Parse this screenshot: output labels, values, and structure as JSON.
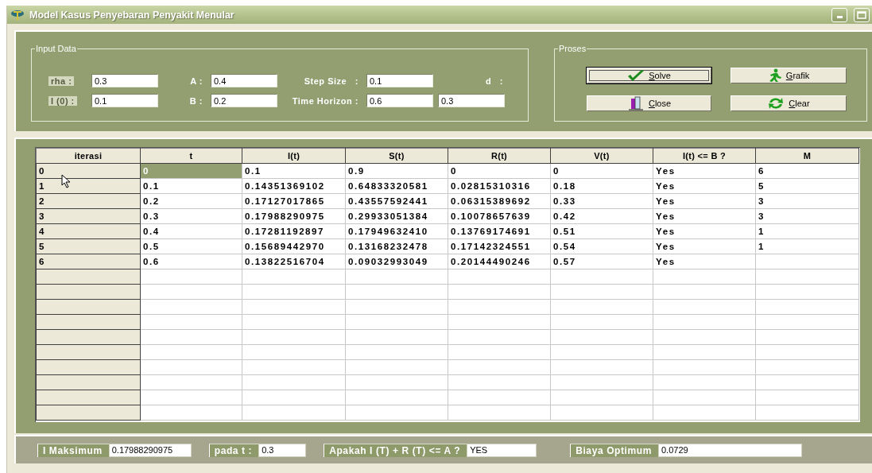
{
  "window": {
    "title": "Model Kasus Penyebaran Penyakit Menular"
  },
  "input_data": {
    "title": "Input Data",
    "rows": [
      [
        {
          "kind": "label",
          "text": "rha :",
          "highlighted": true
        },
        {
          "kind": "field",
          "value": "0.3"
        },
        {
          "kind": "label",
          "text": "A :",
          "highlighted": false
        },
        {
          "kind": "field",
          "value": "0.4"
        },
        {
          "kind": "label",
          "text": "Step Size   :",
          "highlighted": false
        },
        {
          "kind": "field",
          "value": "0.1"
        },
        {
          "kind": "label",
          "text": "d   :",
          "highlighted": false
        }
      ],
      [
        {
          "kind": "label",
          "text": "I (0) :",
          "highlighted": true
        },
        {
          "kind": "field",
          "value": "0.1"
        },
        {
          "kind": "label",
          "text": "B :",
          "highlighted": false
        },
        {
          "kind": "field",
          "value": "0.2"
        },
        {
          "kind": "label",
          "text": "Time Horizon :",
          "highlighted": false
        },
        {
          "kind": "field",
          "value": "0.6"
        },
        {
          "kind": "field",
          "value": "0.3"
        }
      ]
    ]
  },
  "proses": {
    "title": "Proses",
    "buttons": [
      {
        "label": "Solve",
        "kind": "check",
        "focused": true
      },
      {
        "label": "Grafik",
        "kind": "runner",
        "focused": false
      },
      {
        "label": "Close",
        "kind": "door",
        "focused": false
      },
      {
        "label": "Clear",
        "kind": "refresh",
        "focused": false
      }
    ]
  },
  "table": {
    "columns": [
      "iterasi",
      "t",
      "I(t)",
      "S(t)",
      "R(t)",
      "V(t)",
      "I(t) <= B ?",
      "M"
    ],
    "rows": [
      {
        "cells": [
          {
            "text": "0",
            "selected": false
          },
          {
            "text": "0",
            "selected": true
          },
          {
            "text": "0.1",
            "selected": false
          },
          {
            "text": "0.9",
            "selected": false
          },
          {
            "text": "0",
            "selected": false
          },
          {
            "text": "0",
            "selected": false
          },
          {
            "text": "Yes",
            "selected": false
          },
          {
            "text": "6",
            "selected": false
          }
        ]
      },
      {
        "cells": [
          {
            "text": "1",
            "selected": false
          },
          {
            "text": "0.1",
            "selected": false
          },
          {
            "text": "0.14351369102",
            "selected": false
          },
          {
            "text": "0.64833320581",
            "selected": false
          },
          {
            "text": "0.02815310316",
            "selected": false
          },
          {
            "text": "0.18",
            "selected": false
          },
          {
            "text": "Yes",
            "selected": false
          },
          {
            "text": "5",
            "selected": false
          }
        ]
      },
      {
        "cells": [
          {
            "text": "2",
            "selected": false
          },
          {
            "text": "0.2",
            "selected": false
          },
          {
            "text": "0.17127017865",
            "selected": false
          },
          {
            "text": "0.43557592441",
            "selected": false
          },
          {
            "text": "0.06315389692",
            "selected": false
          },
          {
            "text": "0.33",
            "selected": false
          },
          {
            "text": "Yes",
            "selected": false
          },
          {
            "text": "3",
            "selected": false
          }
        ]
      },
      {
        "cells": [
          {
            "text": "3",
            "selected": false
          },
          {
            "text": "0.3",
            "selected": false
          },
          {
            "text": "0.17988290975",
            "selected": false
          },
          {
            "text": "0.29933051384",
            "selected": false
          },
          {
            "text": "0.10078657639",
            "selected": false
          },
          {
            "text": "0.42",
            "selected": false
          },
          {
            "text": "Yes",
            "selected": false
          },
          {
            "text": "3",
            "selected": false
          }
        ]
      },
      {
        "cells": [
          {
            "text": "4",
            "selected": false
          },
          {
            "text": "0.4",
            "selected": false
          },
          {
            "text": "0.17281192897",
            "selected": false
          },
          {
            "text": "0.17949632410",
            "selected": false
          },
          {
            "text": "0.13769174691",
            "selected": false
          },
          {
            "text": "0.51",
            "selected": false
          },
          {
            "text": "Yes",
            "selected": false
          },
          {
            "text": "1",
            "selected": false
          }
        ]
      },
      {
        "cells": [
          {
            "text": "5",
            "selected": false
          },
          {
            "text": "0.5",
            "selected": false
          },
          {
            "text": "0.15689442970",
            "selected": false
          },
          {
            "text": "0.13168232478",
            "selected": false
          },
          {
            "text": "0.17142324551",
            "selected": false
          },
          {
            "text": "0.54",
            "selected": false
          },
          {
            "text": "Yes",
            "selected": false
          },
          {
            "text": "1",
            "selected": false
          }
        ]
      },
      {
        "cells": [
          {
            "text": "6",
            "selected": false
          },
          {
            "text": "0.6",
            "selected": false
          },
          {
            "text": "0.13822516704",
            "selected": false
          },
          {
            "text": "0.09032993049",
            "selected": false
          },
          {
            "text": "0.20144490246",
            "selected": false
          },
          {
            "text": "0.57",
            "selected": false
          },
          {
            "text": "Yes",
            "selected": false
          }
        ]
      }
    ]
  },
  "summary": [
    {
      "label": "I Maksimum",
      "value": "0.17988290975"
    },
    {
      "label": "pada t :",
      "value": "0.3"
    },
    {
      "label": "Apakah I (T) + R (T) <= A ?",
      "value": "YES"
    },
    {
      "label": "Biaya Optimum",
      "value": "0.0729"
    }
  ]
}
